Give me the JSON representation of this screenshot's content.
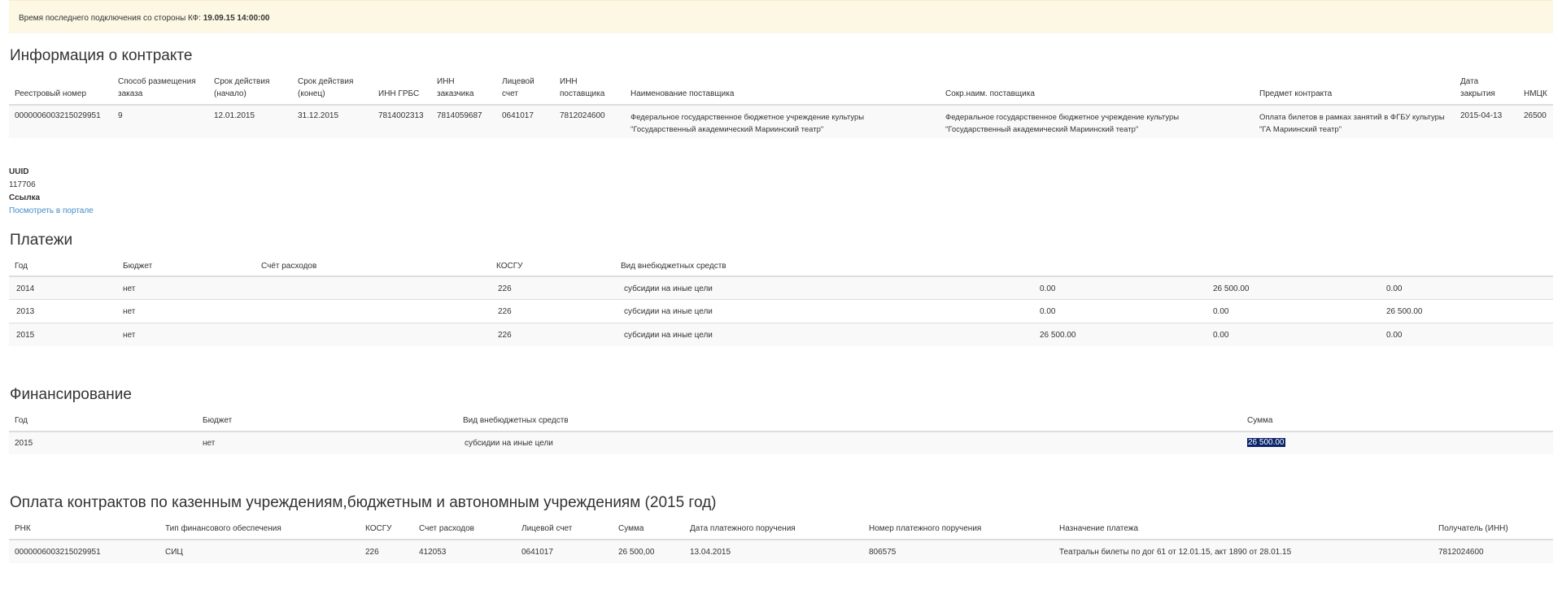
{
  "banner": {
    "label": "Время последнего подключения со стороны КФ:",
    "value": "19.09.15 14:00:00"
  },
  "contract": {
    "title": "Информация о контракте",
    "headers": {
      "reg": "Реестровый номер",
      "method": "Способ размещения заказа",
      "start": "Срок действия (начало)",
      "end": "Срок действия (конец)",
      "inn_grbs": "ИНН ГРБС",
      "inn_customer": "ИНН заказчика",
      "account": "Лицевой счет",
      "inn_supplier": "ИНН поставщика",
      "supplier_name": "Наименование поставщика",
      "supplier_short": "Сокр.наим. поставщика",
      "subject": "Предмет контракта",
      "close_date": "Дата закрытия",
      "nmck": "НМЦК"
    },
    "row": {
      "reg": "0000006003215029951",
      "method": "9",
      "start": "12.01.2015",
      "end": "31.12.2015",
      "inn_grbs": "7814002313",
      "inn_customer": "7814059687",
      "account": "0641017",
      "inn_supplier": "7812024600",
      "supplier_name": "Федеральное государственное бюджетное учреждение культуры \"Государственный академический Мариинский театр\"",
      "supplier_short": "Федеральное государственное бюджетное учреждение культуры \"Государственный академический Мариинский театр\"",
      "subject": "Оплата билетов в рамках занятий в ФГБУ культуры \"ГА Мариинский театр\"",
      "close_date": "2015-04-13",
      "nmck": "26500"
    }
  },
  "meta": {
    "uuid_label": "UUID",
    "uuid_value": "117706",
    "link_label": "Ссылка",
    "link_text": "Посмотреть в портале"
  },
  "payments": {
    "title": "Платежи",
    "headers": {
      "year": "Год",
      "budget": "Бюджет",
      "account": "Счёт расходов",
      "kosgu": "КОСГУ",
      "kind": "Вид внебюджетных средств"
    },
    "rows": [
      {
        "year": "2014",
        "budget": "нет",
        "kosgu": "226",
        "kind": "субсидии на иные цели",
        "v1": "0.00",
        "v2": "26 500.00",
        "v3": "0.00"
      },
      {
        "year": "2013",
        "budget": "нет",
        "kosgu": "226",
        "kind": "субсидии на иные цели",
        "v1": "0.00",
        "v2": "0.00",
        "v3": "26 500.00"
      },
      {
        "year": "2015",
        "budget": "нет",
        "kosgu": "226",
        "kind": "субсидии на иные цели",
        "v1": "26 500.00",
        "v2": "0.00",
        "v3": "0.00"
      }
    ]
  },
  "financing": {
    "title": "Финансирование",
    "headers": {
      "year": "Год",
      "budget": "Бюджет",
      "kind": "Вид внебюджетных средств",
      "sum": "Сумма"
    },
    "row": {
      "year": "2015",
      "budget": "нет",
      "kind": "субсидии на иные цели",
      "sum": "26 500.00"
    }
  },
  "contract_payments": {
    "title": "Оплата контрактов по казенным учреждениям,бюджетным и автономным учреждениям (2015 год)",
    "headers": {
      "rnk": "РНК",
      "fin_type": "Тип финансового обеспечения",
      "kosgu": "КОСГУ",
      "account": "Счет расходов",
      "personal": "Лицевой счет",
      "sum": "Сумма",
      "order_date": "Дата платежного поручения",
      "order_num": "Номер платежного поручения",
      "purpose": "Назначение платежа",
      "recipient": "Получатель (ИНН)"
    },
    "row": {
      "rnk": "0000006003215029951",
      "fin_type": "СИЦ",
      "kosgu": "226",
      "account": "412053",
      "personal": "0641017",
      "sum": "26 500,00",
      "order_date": "13.04.2015",
      "order_num": "806575",
      "purpose": "Театральн билеты по дог 61 от 12.01.15, акт 1890 от 28.01.15",
      "recipient": "7812024600"
    }
  }
}
